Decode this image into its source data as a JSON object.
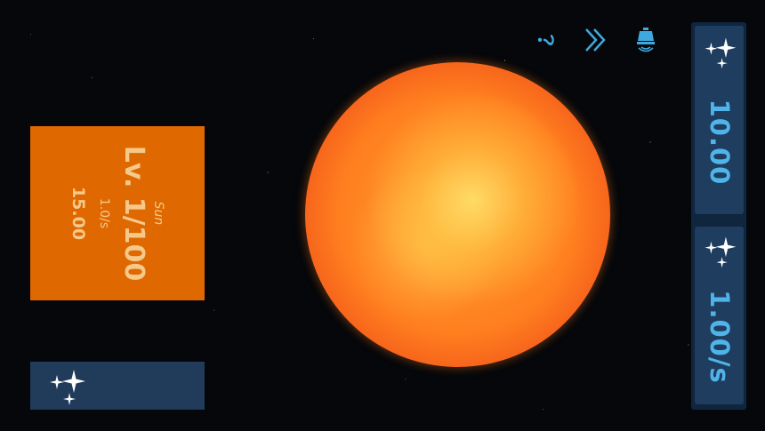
{
  "planet_card": {
    "name": "Sun",
    "level": "Lv. 1/100",
    "rate": "1.0/s",
    "value": "15.00"
  },
  "currency_panel": {
    "total": "10.00",
    "per_second": "1.00/s"
  },
  "icons": {
    "help": "help-icon",
    "fast_forward": "fast-forward-icon",
    "notification": "bell-icon",
    "sparkle": "sparkle-icon"
  },
  "colors": {
    "card_orange": "#e06800",
    "panel_navy": "#1f3d5f",
    "accent_blue": "#4fb4ea",
    "card_text": "#f4c98a"
  }
}
